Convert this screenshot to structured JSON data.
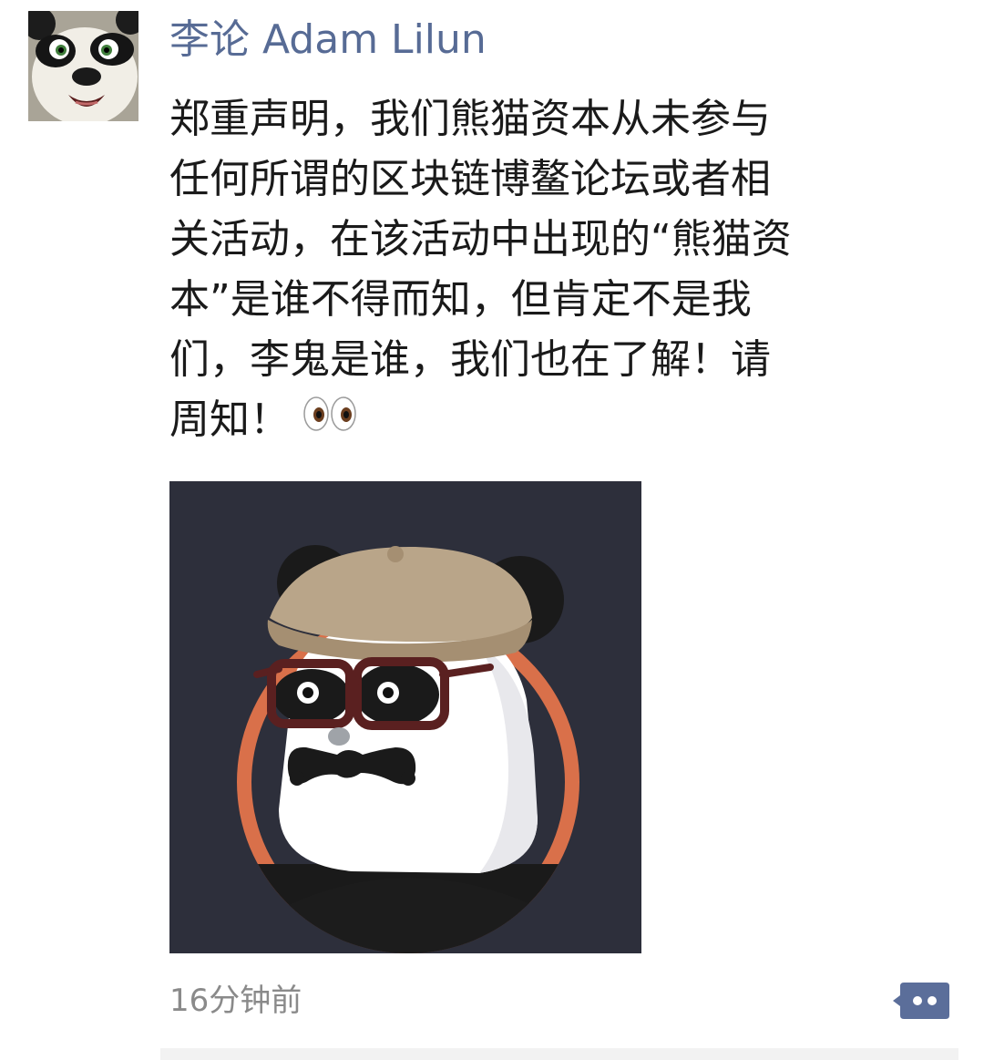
{
  "post": {
    "author_name": "李论 Adam Lilun",
    "avatar_icon": "kung-fu-panda-avatar",
    "text_lines": [
      "郑重声明，我们熊猫资本从未参与",
      "任何所谓的区块链博鳌论坛或者相",
      "关活动，在该活动中出现的“熊猫资",
      "本”是谁不得而知，但肯定不是我",
      "们，李鬼是谁，我们也在了解！请",
      "周知！"
    ],
    "emoji_icon": "eyes-emoji",
    "image_icon": "panda-capital-logo",
    "timestamp": "16分钟前",
    "comment_icon": "comment-icon"
  },
  "colors": {
    "author_name": "#576b95",
    "text": "#1a1a1a",
    "timestamp": "#8a8a8a",
    "image_background": "#2d2f3b",
    "logo_ring": "#d9704a",
    "comment_button": "#5b6e9a"
  }
}
